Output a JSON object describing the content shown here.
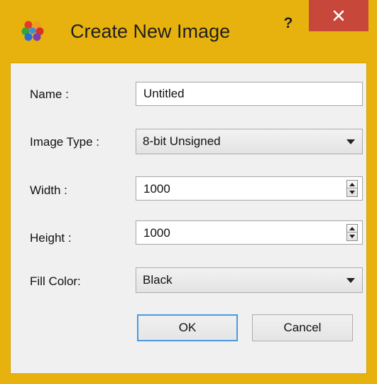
{
  "window": {
    "title": "Create New Image",
    "help_glyph": "?",
    "close_icon": "close-icon",
    "app_icon": "image-app-icon"
  },
  "form": {
    "name_label": "Name :",
    "name_value": "Untitled",
    "image_type_label": "Image Type :",
    "image_type_value": "8-bit Unsigned",
    "width_label": "Width :",
    "width_value": "1000",
    "height_label": "Height :",
    "height_value": "1000",
    "fill_color_label": "Fill Color:",
    "fill_color_value": "Black"
  },
  "buttons": {
    "ok_label": "OK",
    "cancel_label": "Cancel"
  },
  "colors": {
    "frame": "#e8b20e",
    "close_button": "#c7473a",
    "default_button_border": "#4a9be3"
  }
}
